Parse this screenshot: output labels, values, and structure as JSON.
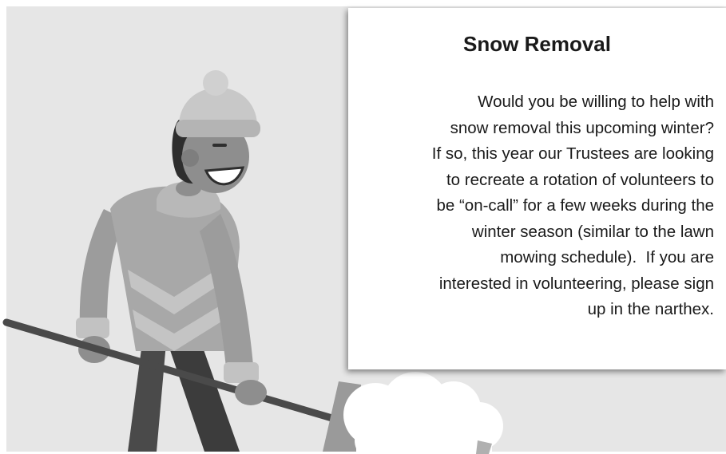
{
  "flyer": {
    "title": "Snow Removal",
    "body": [
      "Would you be willing to help with",
      "snow removal this upcoming winter?",
      "If so, this year our Trustees are looking",
      "to recreate a rotation of volunteers to",
      "be “on-call” for a few weeks during the",
      "winter season (similar to the lawn",
      "mowing schedule).  If you are",
      "interested in volunteering, please sign",
      "up in the narthex."
    ]
  },
  "illustration": {
    "subject": "person-shoveling-snow",
    "colors": {
      "background": "#e6e6e6",
      "hat": "#c8c8c8",
      "sweater": "#a8a8a8",
      "skin": "#8e8e8e",
      "pants": "#3c3c3c",
      "shovel_handle": "#4a4a4a",
      "snow": "#ffffff"
    }
  }
}
